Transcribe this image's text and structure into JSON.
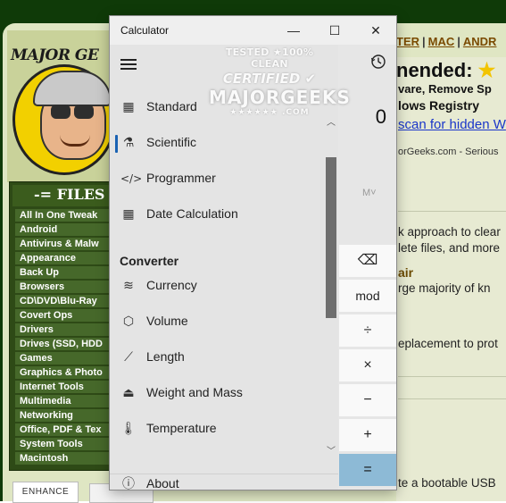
{
  "website": {
    "logo_text": "MAJOR GE",
    "files_heading": "-= FILES",
    "categories": [
      "All In One Tweak",
      "Android",
      "Antivirus & Malw",
      "Appearance",
      "Back Up",
      "Browsers",
      "CD\\DVD\\Blu-Ray",
      "Covert Ops",
      "Drivers",
      "Drives (SSD, HDD",
      "Games",
      "Graphics & Photo",
      "Internet Tools",
      "Multimedia",
      "Networking",
      "Office, PDF & Tex",
      "System Tools",
      "Macintosh"
    ],
    "enhance_label": "ENHANCE",
    "nav_links": [
      "TER",
      "MAC",
      "ANDR"
    ],
    "recommended_heading": "nended:",
    "recommended_line1_a": "vare,",
    "recommended_line1_b": " Remove Sp",
    "recommended_line2": "lows Registry",
    "recommended_link": "scan for hidden W",
    "recommended_small": "orGeeks.com - Serious",
    "para1_line1": "k approach to clear",
    "para1_line2": "lete files, and more",
    "air_title": "air",
    "para2": "rge majority of kn",
    "para3": "eplacement to prot",
    "para4": "te a bootable USB"
  },
  "watermark": {
    "line1": "TESTED ★100% CLEAN",
    "line2": "CERTIFIED ✔",
    "line3": "MAJORGEEKS",
    "line4": "★★★★★★ .COM"
  },
  "calculator": {
    "title": "Calculator",
    "window_controls": {
      "minimize": "—",
      "maximize": "☐",
      "close": "✕"
    },
    "display_value": "0",
    "memory_label": "M˅",
    "keys": [
      "⌫",
      "mod",
      "÷",
      "×",
      "−",
      "+",
      "="
    ],
    "nav": {
      "items": [
        {
          "label": "Standard",
          "icon": "standard-calculator-icon"
        },
        {
          "label": "Scientific",
          "icon": "flask-icon"
        },
        {
          "label": "Programmer",
          "icon": "code-icon"
        },
        {
          "label": "Date Calculation",
          "icon": "calendar-icon"
        }
      ],
      "converter_heading": "Converter",
      "converters": [
        {
          "label": "Currency",
          "icon": "currency-icon"
        },
        {
          "label": "Volume",
          "icon": "cube-icon"
        },
        {
          "label": "Length",
          "icon": "ruler-icon"
        },
        {
          "label": "Weight and Mass",
          "icon": "weight-icon"
        },
        {
          "label": "Temperature",
          "icon": "thermometer-icon"
        }
      ],
      "about_label": "About",
      "active_item": "Scientific"
    },
    "colors": {
      "accent": "#1a62b3",
      "equals_key": "#8dbad6",
      "nav_bg": "#e4e4e4"
    }
  }
}
